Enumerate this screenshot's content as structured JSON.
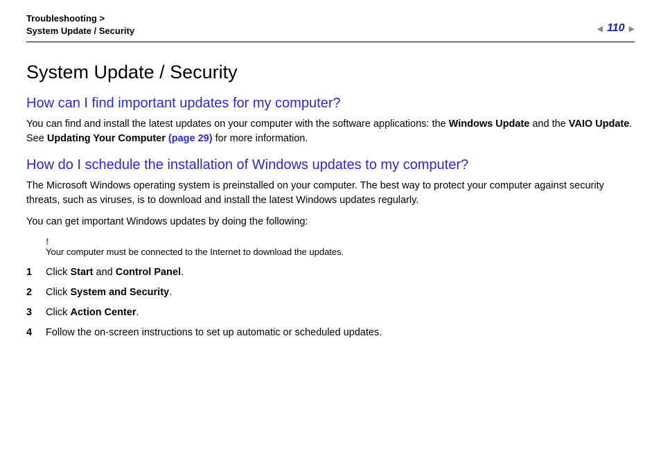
{
  "header": {
    "breadcrumb_line1": "Troubleshooting >",
    "breadcrumb_line2": "System Update / Security",
    "page_number": "110"
  },
  "title": "System Update / Security",
  "section1": {
    "heading": "How can I find important updates for my computer?",
    "p1a": "You can find and install the latest updates on your computer with the software applications: the ",
    "p1b": "Windows Update",
    "p1c": " and the ",
    "p1d": "VAIO Update",
    "p1e": ". See ",
    "p1f": "Updating Your Computer ",
    "p1g": "(page 29)",
    "p1h": " for more information."
  },
  "section2": {
    "heading": "How do I schedule the installation of Windows updates to my computer?",
    "p1": "The Microsoft Windows operating system is preinstalled on your computer. The best way to protect your computer against security threats, such as viruses, is to download and install the latest Windows updates regularly.",
    "p2": "You can get important Windows updates by doing the following:",
    "warning_mark": "!",
    "warning_text": "Your computer must be connected to the Internet to download the updates.",
    "steps": [
      {
        "n": "1",
        "pre": "Click ",
        "b1": "Start",
        "mid": " and ",
        "b2": "Control Panel",
        "post": "."
      },
      {
        "n": "2",
        "pre": "Click ",
        "b1": "System and Security",
        "mid": "",
        "b2": "",
        "post": "."
      },
      {
        "n": "3",
        "pre": "Click ",
        "b1": "Action Center",
        "mid": "",
        "b2": "",
        "post": "."
      },
      {
        "n": "4",
        "pre": "Follow the on-screen instructions to set up automatic or scheduled updates.",
        "b1": "",
        "mid": "",
        "b2": "",
        "post": ""
      }
    ]
  }
}
